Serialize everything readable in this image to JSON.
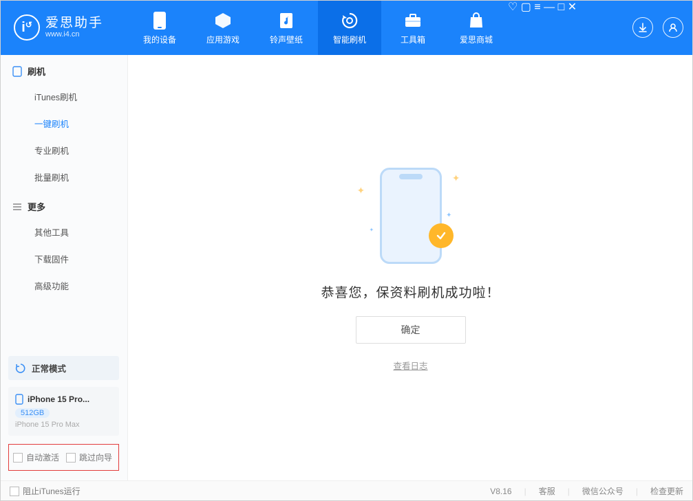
{
  "app": {
    "name": "爱思助手",
    "url": "www.i4.cn"
  },
  "tabs": [
    {
      "label": "我的设备"
    },
    {
      "label": "应用游戏"
    },
    {
      "label": "铃声壁纸"
    },
    {
      "label": "智能刷机",
      "active": true
    },
    {
      "label": "工具箱"
    },
    {
      "label": "爱思商城"
    }
  ],
  "sidebar": {
    "group1": {
      "title": "刷机",
      "items": [
        "iTunes刷机",
        "一键刷机",
        "专业刷机",
        "批量刷机"
      ],
      "active_index": 1
    },
    "group2": {
      "title": "更多",
      "items": [
        "其他工具",
        "下载固件",
        "高级功能"
      ]
    },
    "mode": "正常模式",
    "device": {
      "title": "iPhone 15 Pro...",
      "badge": "512GB",
      "sub": "iPhone 15 Pro Max"
    },
    "checkboxes": {
      "a": "自动激活",
      "b": "跳过向导"
    }
  },
  "main": {
    "success_text": "恭喜您，保资料刷机成功啦！",
    "confirm": "确定",
    "log_link": "查看日志"
  },
  "footer": {
    "block_itunes": "阻止iTunes运行",
    "version": "V8.16",
    "links": [
      "客服",
      "微信公众号",
      "检查更新"
    ]
  }
}
